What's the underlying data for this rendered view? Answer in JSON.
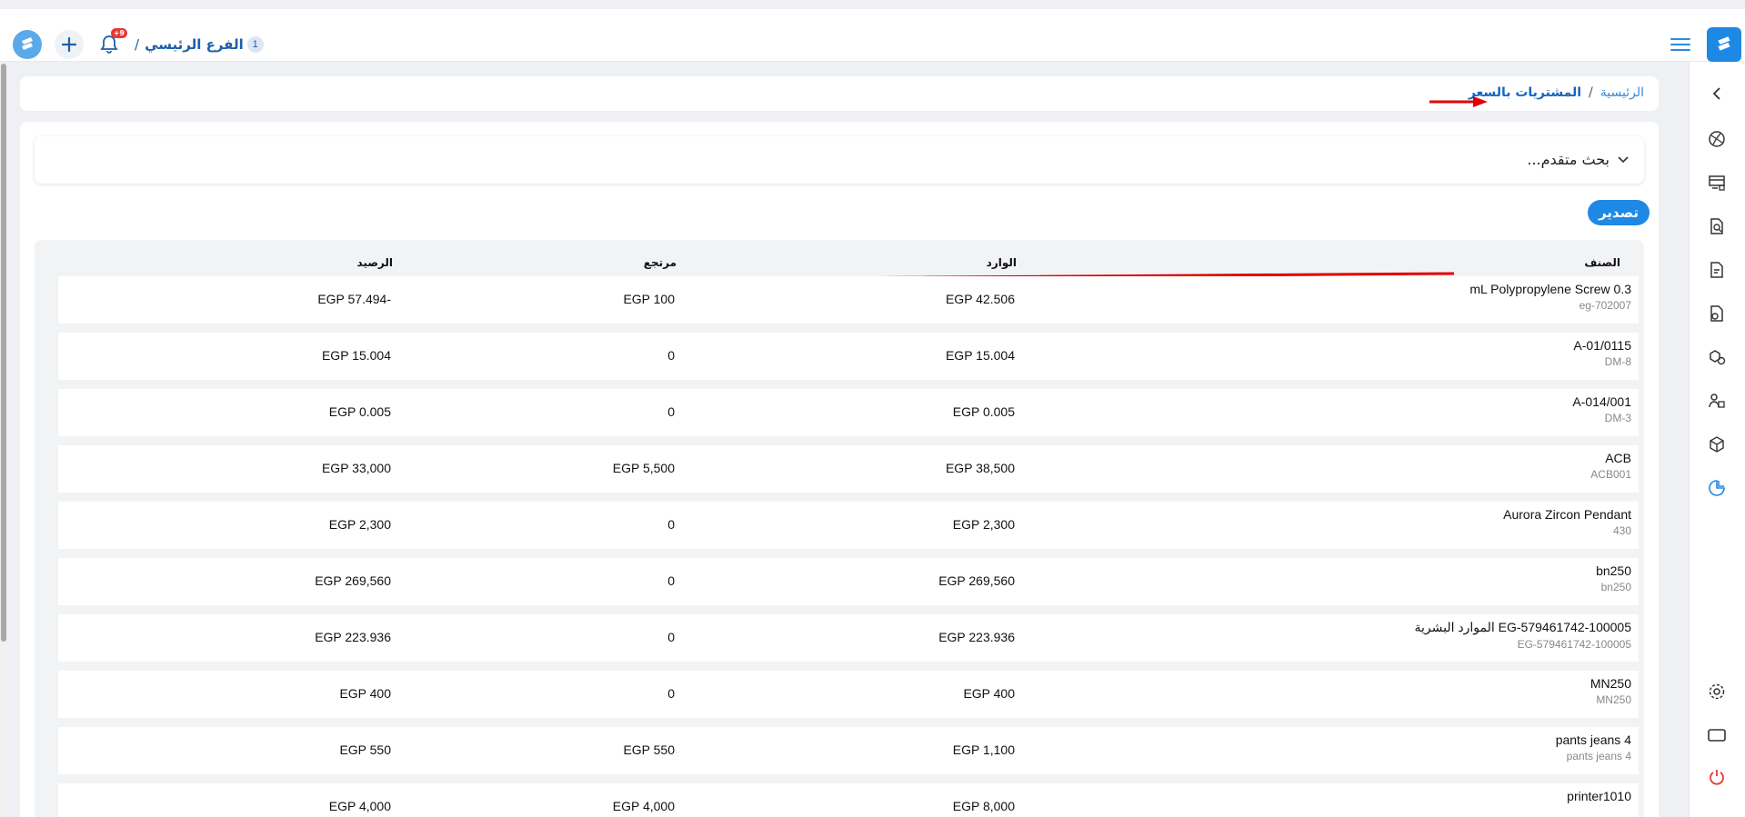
{
  "topbar": {
    "branch_number": "1",
    "branch_name": "الفرع الرئيسي",
    "branch_sep": "/",
    "notif_badge": "+9"
  },
  "breadcrumb": {
    "home": "الرئيسية",
    "separator": "/",
    "current": "المشتريات بالسعر"
  },
  "advanced_search": {
    "label": "بحث متقدم..."
  },
  "export_label": "تصدير",
  "table": {
    "headers": {
      "item": "الصنف",
      "incoming": "الوارد",
      "returned": "مرتجع",
      "balance": "الرصيد"
    },
    "rows": [
      {
        "name": "mL Polypropylene Screw 0.3",
        "code": "eg-702007",
        "incoming": "EGP 42.506",
        "returned": "EGP 100",
        "balance": "EGP 57.494-"
      },
      {
        "name": "A-01/0115",
        "code": "DM-8",
        "incoming": "EGP 15.004",
        "returned": "0",
        "balance": "EGP 15.004"
      },
      {
        "name": "A-014/001",
        "code": "DM-3",
        "incoming": "EGP 0.005",
        "returned": "0",
        "balance": "EGP 0.005"
      },
      {
        "name": "ACB",
        "code": "ACB001",
        "incoming": "EGP 38,500",
        "returned": "EGP 5,500",
        "balance": "EGP 33,000"
      },
      {
        "name": "Aurora Zircon Pendant",
        "code": "430",
        "incoming": "EGP 2,300",
        "returned": "0",
        "balance": "EGP 2,300"
      },
      {
        "name": "bn250",
        "code": "bn250",
        "incoming": "EGP 269,560",
        "returned": "0",
        "balance": "EGP 269,560"
      },
      {
        "name": "EG-579461742-100005 الموارد البشرية",
        "code": "EG-579461742-100005",
        "incoming": "EGP 223.936",
        "returned": "0",
        "balance": "EGP 223.936"
      },
      {
        "name": "MN250",
        "code": "MN250",
        "incoming": "EGP 400",
        "returned": "0",
        "balance": "EGP 400"
      },
      {
        "name": "pants jeans 4",
        "code": "pants jeans 4",
        "incoming": "EGP 1,100",
        "returned": "EGP 550",
        "balance": "EGP 550"
      },
      {
        "name": "printer1010",
        "code": "",
        "incoming": "EGP 8,000",
        "returned": "EGP 4,000",
        "balance": "EGP 4,000"
      }
    ]
  },
  "colors": {
    "accent": "#1e88e5",
    "annotation": "#e00000"
  },
  "sidebar_icons": [
    "collapse-arrow-icon",
    "globe-icon",
    "pos-icon",
    "search-doc-icon",
    "invoice-icon",
    "document-user-icon",
    "boxes-icon",
    "users-settings-icon",
    "package-icon",
    "reports-chart-icon",
    "settings-icon",
    "window-icon",
    "power-icon"
  ]
}
